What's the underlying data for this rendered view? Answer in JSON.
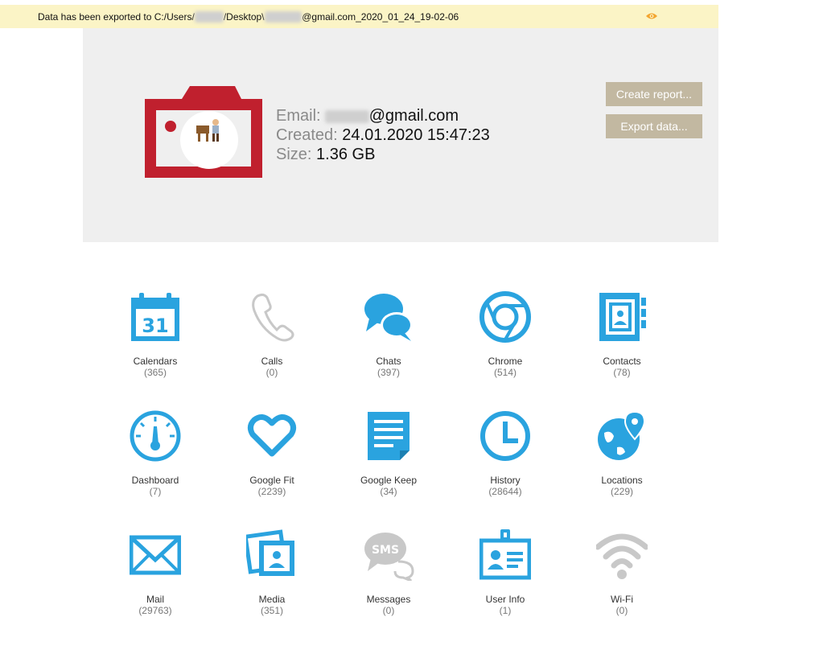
{
  "notification": {
    "prefix": "Data has been exported to C:/Users/",
    "user_redacted": "hidden",
    "mid": "/Desktop\\",
    "email_redacted": "redacted",
    "suffix": "@gmail.com_2020_01_24_19-02-06"
  },
  "account": {
    "email_label": "Email:",
    "email_redacted": "redacted",
    "email_domain": "@gmail.com",
    "created_label": "Created:",
    "created_value": "24.01.2020 15:47:23",
    "size_label": "Size:",
    "size_value": "1.36 GB"
  },
  "actions": {
    "create_report": "Create report...",
    "export_data": "Export data..."
  },
  "colors": {
    "accent": "#2aa3df",
    "disabled": "#c8c8c8",
    "logo_red": "#c0202e",
    "button_bg": "#c2b8a1",
    "notification_bg": "#fbf4c6"
  },
  "categories": [
    {
      "label": "Calendars",
      "count": "(365)",
      "icon": "calendar-icon",
      "active": true
    },
    {
      "label": "Calls",
      "count": "(0)",
      "icon": "phone-icon",
      "active": false
    },
    {
      "label": "Chats",
      "count": "(397)",
      "icon": "chat-bubbles-icon",
      "active": true
    },
    {
      "label": "Chrome",
      "count": "(514)",
      "icon": "chrome-icon",
      "active": true
    },
    {
      "label": "Contacts",
      "count": "(78)",
      "icon": "contact-book-icon",
      "active": true
    },
    {
      "label": "Dashboard",
      "count": "(7)",
      "icon": "gauge-icon",
      "active": true
    },
    {
      "label": "Google Fit",
      "count": "(2239)",
      "icon": "heart-icon",
      "active": true
    },
    {
      "label": "Google Keep",
      "count": "(34)",
      "icon": "note-icon",
      "active": true
    },
    {
      "label": "History",
      "count": "(28644)",
      "icon": "clock-icon",
      "active": true
    },
    {
      "label": "Locations",
      "count": "(229)",
      "icon": "globe-pin-icon",
      "active": true
    },
    {
      "label": "Mail",
      "count": "(29763)",
      "icon": "envelope-icon",
      "active": true
    },
    {
      "label": "Media",
      "count": "(351)",
      "icon": "photo-icon",
      "active": true
    },
    {
      "label": "Messages",
      "count": "(0)",
      "icon": "sms-icon",
      "active": false
    },
    {
      "label": "User Info",
      "count": "(1)",
      "icon": "id-badge-icon",
      "active": true
    },
    {
      "label": "Wi-Fi",
      "count": "(0)",
      "icon": "wifi-icon",
      "active": false
    }
  ]
}
